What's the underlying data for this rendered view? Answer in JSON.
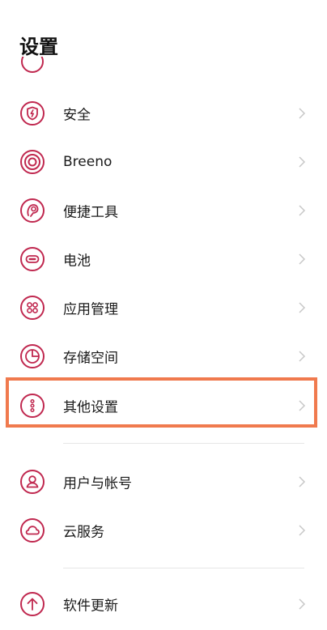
{
  "header": {
    "title": "设置"
  },
  "colors": {
    "accent": "#c0284f",
    "highlight": "#f07a4e",
    "chevron": "#c8c8c8"
  },
  "items": [
    {
      "id": "security",
      "label": "安全",
      "icon": "shield-icon"
    },
    {
      "id": "breeno",
      "label": "Breeno",
      "icon": "breeno-icon"
    },
    {
      "id": "convenience",
      "label": "便捷工具",
      "icon": "tools-icon"
    },
    {
      "id": "battery",
      "label": "电池",
      "icon": "battery-icon"
    },
    {
      "id": "apps",
      "label": "应用管理",
      "icon": "apps-grid-icon"
    },
    {
      "id": "storage",
      "label": "存储空间",
      "icon": "pie-chart-icon"
    },
    {
      "id": "other",
      "label": "其他设置",
      "icon": "more-dots-icon"
    },
    {
      "id": "account",
      "label": "用户与帐号",
      "icon": "user-icon"
    },
    {
      "id": "cloud",
      "label": "云服务",
      "icon": "cloud-icon"
    },
    {
      "id": "update",
      "label": "软件更新",
      "icon": "arrow-up-icon"
    }
  ]
}
